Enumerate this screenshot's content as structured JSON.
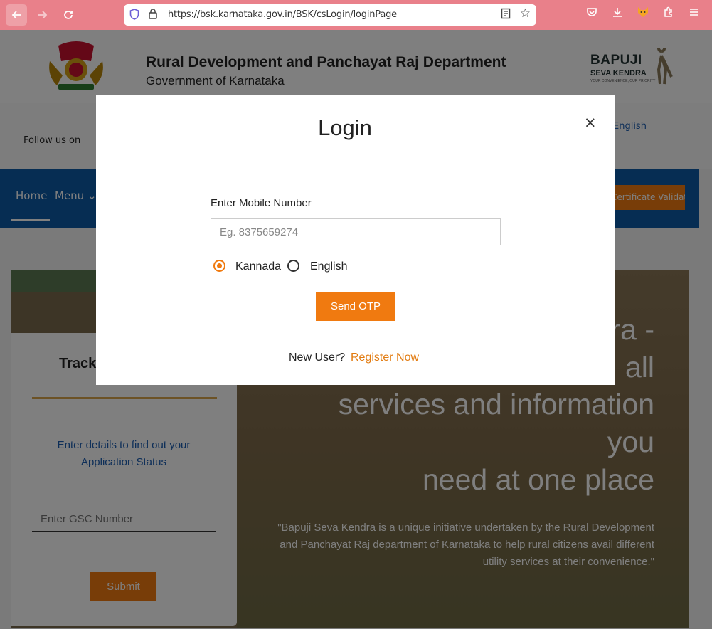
{
  "browser": {
    "url": "https://bsk.karnataka.gov.in/BSK/csLogin/loginPage",
    "back_icon": "arrow-left-icon",
    "forward_icon": "arrow-right-icon",
    "reload_icon": "reload-icon",
    "toolbar_icons": [
      "pocket-icon",
      "download-icon",
      "extension-fox-icon",
      "extensions-icon",
      "menu-icon"
    ]
  },
  "header": {
    "title": "Rural Development and Panchayat Raj Department",
    "subtitle": "Government of Karnataka",
    "logo_name": "BAPUJI",
    "logo_sub": "SEVA KENDRA",
    "logo_tag": "YOUR CONVENIENCE, OUR PRIORITY"
  },
  "social": {
    "follow": "Follow us on",
    "language": "English"
  },
  "nav": {
    "home": "Home",
    "menu": "Menu",
    "certificate": "Certificate Validation"
  },
  "track": {
    "title": "Track",
    "desc": "Enter details to find out your Application Status",
    "placeholder": "Enter GSC Number",
    "submit": "Submit"
  },
  "hero": {
    "line1": "ra -",
    "line2": "all",
    "line3": "services and information",
    "line4": "you",
    "line5": "need at one place",
    "quote": "\"Bapuji Seva Kendra is a unique initiative undertaken by the Rural Development and Panchayat Raj department of Karnataka to help rural citizens avail different utility services at their convenience.\""
  },
  "modal": {
    "title": "Login",
    "close": "×",
    "mobile_label": "Enter Mobile Number",
    "mobile_placeholder": "Eg. 8375659274",
    "lang_kannada": "Kannada",
    "lang_english": "English",
    "selected_lang": "Kannada",
    "send_otp": "Send OTP",
    "new_user": "New User?",
    "register": "Register Now"
  },
  "colors": {
    "accent": "#f07a10",
    "nav_blue": "#0d5aa7",
    "chrome": "#e9808a"
  }
}
